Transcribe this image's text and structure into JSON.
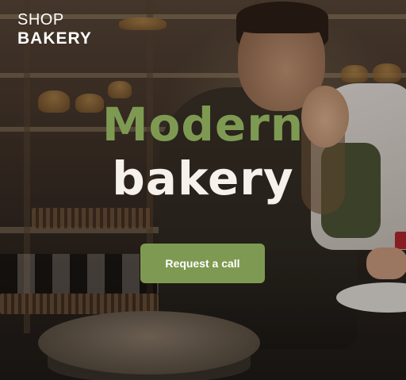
{
  "brand": {
    "line1": "SHOP",
    "line2": "BAKERY"
  },
  "hero": {
    "headline_line1": "Modern",
    "headline_line2": "bakery",
    "cta_label": "Request a call"
  },
  "colors": {
    "accent": "#7e9a52",
    "headline_light": "#f6f1ea",
    "text": "#ffffff"
  }
}
